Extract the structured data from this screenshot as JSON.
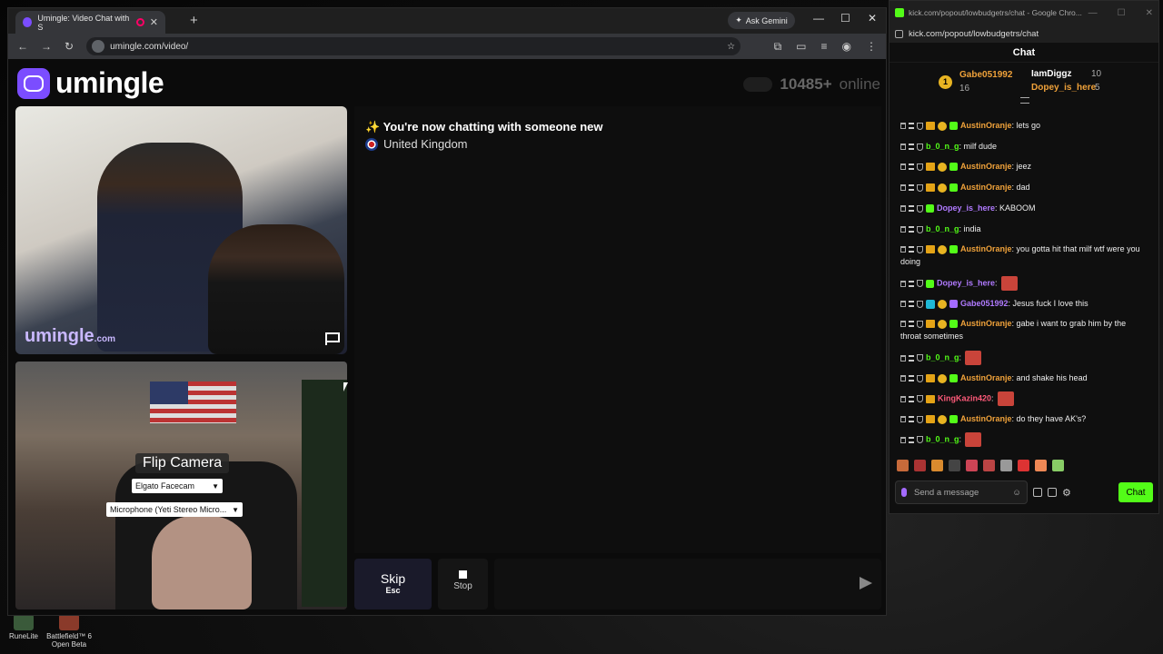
{
  "left_browser": {
    "tab_title": "Umingle: Video Chat with S",
    "ask_gemini": "Ask Gemini",
    "url": "umingle.com/video/"
  },
  "site": {
    "brand": "umingle",
    "online_count": "10485+",
    "online_label": "online",
    "watermark": "umingle",
    "watermark_suffix": ".com"
  },
  "local_video": {
    "flip_label": "Flip Camera",
    "camera_select": "Elgato Facecam",
    "mic_select": "Microphone (Yeti Stereo Micro..."
  },
  "chat_panel": {
    "status": "✨ You're now chatting with someone new",
    "country": "United Kingdom"
  },
  "controls": {
    "skip_label": "Skip",
    "skip_key": "Esc",
    "stop_label": "Stop"
  },
  "right_browser": {
    "title": "kick.com/popout/lowbudgetrs/chat - Google Chro...",
    "url": "kick.com/popout/lowbudgetrs/chat",
    "header": "Chat",
    "pinned": {
      "top_rank": "1",
      "top_user": "Gabe051992",
      "top_count": "16",
      "user2": "IamDiggz",
      "user2_count": "10",
      "user3": "Dopey_is_here",
      "user3_count": "5"
    },
    "messages": [
      {
        "user": "AustinOranje",
        "text": ": lets go",
        "color": "#f0a23a",
        "badges": "cc"
      },
      {
        "user": "b_0_n_g",
        "text": ": milf dude",
        "color": "#53fc18",
        "badges": ""
      },
      {
        "user": "AustinOranje",
        "text": ": jeez",
        "color": "#f0a23a",
        "badges": "cc"
      },
      {
        "user": "AustinOranje",
        "text": ": dad",
        "color": "#f0a23a",
        "badges": "cc"
      },
      {
        "user": "Dopey_is_here",
        "text": ": KABOOM",
        "color": "#b07aff",
        "badges": "m"
      },
      {
        "user": "b_0_n_g",
        "text": ": india",
        "color": "#53fc18",
        "badges": ""
      },
      {
        "user": "AustinOranje",
        "text": ": you gotta hit that milf wtf were you doing",
        "color": "#f0a23a",
        "badges": "cc"
      },
      {
        "user": "Dopey_is_here",
        "text": ":",
        "color": "#b07aff",
        "badges": "m",
        "emote": true
      },
      {
        "user": "Gabe051992",
        "text": ": Jesus fuck I love this",
        "color": "#b07aff",
        "badges": "g"
      },
      {
        "user": "AustinOranje",
        "text": ": gabe i want to grab him by the throat sometimes",
        "color": "#f0a23a",
        "badges": "cc"
      },
      {
        "user": "b_0_n_g",
        "text": ":",
        "color": "#53fc18",
        "badges": "",
        "emote": true
      },
      {
        "user": "AustinOranje",
        "text": ": and shake his head",
        "color": "#f0a23a",
        "badges": "cc"
      },
      {
        "user": "KingKazin420",
        "text": ":",
        "color": "#ff5a7a",
        "badges": "k",
        "emote": true
      },
      {
        "user": "AustinOranje",
        "text": ": do they have AK's?",
        "color": "#f0a23a",
        "badges": "cc"
      },
      {
        "user": "b_0_n_g",
        "text": ":",
        "color": "#53fc18",
        "badges": "",
        "emote": true
      }
    ],
    "input_placeholder": "Send a message",
    "chat_button": "Chat"
  },
  "desktop_icons": [
    {
      "label": "RuneLite"
    },
    {
      "label": "Battlefield™ 6 Open Beta"
    }
  ]
}
